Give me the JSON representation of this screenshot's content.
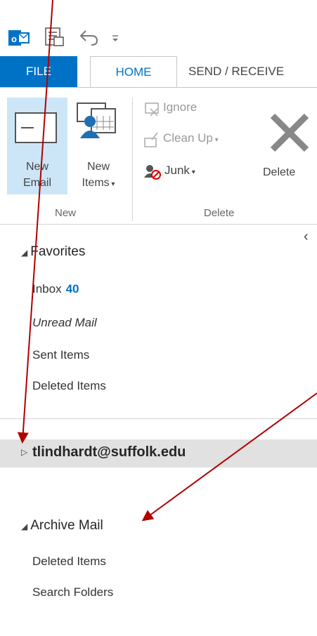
{
  "ribbon": {
    "tabs": {
      "file": "FILE",
      "home": "HOME",
      "send_receive": "SEND / RECEIVE"
    },
    "new_email": {
      "line1": "New",
      "line2": "Email"
    },
    "new_items": {
      "line1": "New",
      "line2": "Items"
    },
    "ignore": "Ignore",
    "clean_up": "Clean Up",
    "junk": "Junk",
    "delete": "Delete",
    "group_new": "New",
    "group_delete": "Delete"
  },
  "nav": {
    "collapse_glyph": "‹",
    "favorites": {
      "label": "Favorites",
      "items": [
        {
          "label": "Inbox",
          "count": "40"
        },
        {
          "label": "Unread Mail"
        },
        {
          "label": "Sent Items"
        },
        {
          "label": "Deleted Items"
        }
      ]
    },
    "account": "tlindhardt@suffolk.edu",
    "archive": {
      "label": "Archive Mail",
      "items": [
        {
          "label": "Deleted Items"
        },
        {
          "label": "Search Folders"
        }
      ]
    }
  },
  "colors": {
    "accent": "#0072c6",
    "annotation_arrow": "#b00000",
    "selected_button": "#cde6f7"
  }
}
